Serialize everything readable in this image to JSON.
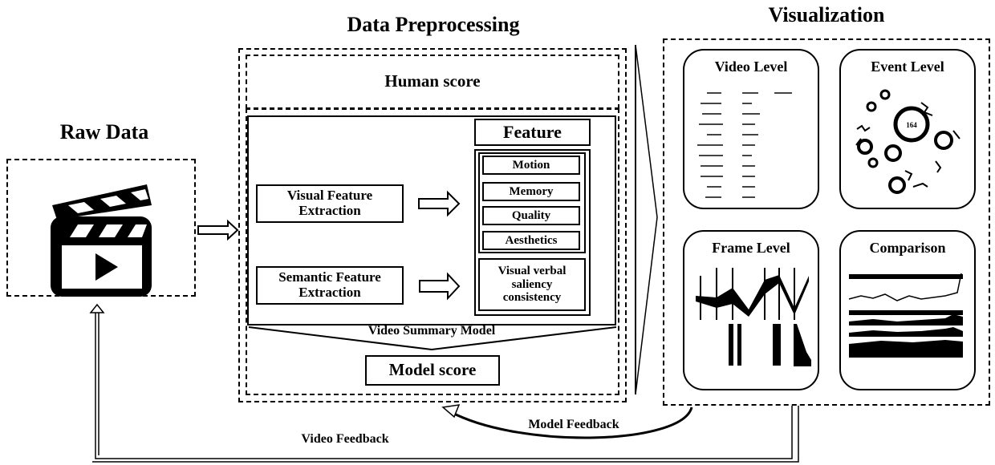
{
  "sections": {
    "raw_data": {
      "title": "Raw Data",
      "icon": "video-clapperboard-icon"
    },
    "preprocessing": {
      "title": "Data Preprocessing",
      "human_score": "Human score",
      "visual_extraction": "Visual Feature Extraction",
      "semantic_extraction": "Semantic Feature Extraction",
      "feature_header": "Feature",
      "visual_features": [
        "Motion",
        "Memory",
        "Quality",
        "Aesthetics"
      ],
      "semantic_feature": "Visual verbal saliency consistency",
      "model_name": "Video Summary Model",
      "model_score": "Model score"
    },
    "visualization": {
      "title": "Visualization",
      "cards": [
        {
          "label": "Video Level"
        },
        {
          "label": "Event Level",
          "center_value": "164"
        },
        {
          "label": "Frame Level"
        },
        {
          "label": "Comparison"
        }
      ]
    }
  },
  "feedback": {
    "model": "Model Feedback",
    "video": "Video Feedback"
  }
}
